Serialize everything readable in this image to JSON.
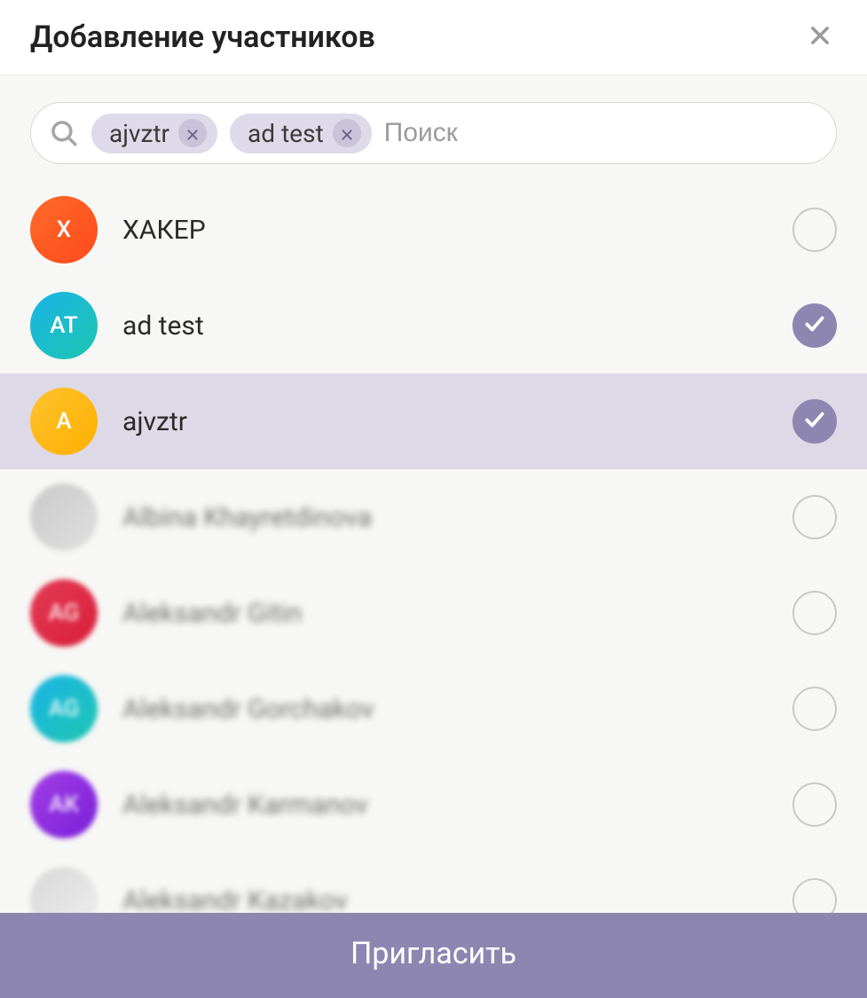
{
  "header": {
    "title": "Добавление участников"
  },
  "search": {
    "placeholder": "Поиск",
    "chips": [
      {
        "label": "ajvztr"
      },
      {
        "label": "ad test"
      }
    ]
  },
  "contacts": [
    {
      "name": "ХАКЕР",
      "initials": "Х",
      "avatar_class": "grad-orange",
      "selected": false,
      "highlighted": false,
      "blurred": false
    },
    {
      "name": "ad test",
      "initials": "AT",
      "avatar_class": "grad-teal",
      "selected": true,
      "highlighted": false,
      "blurred": false
    },
    {
      "name": "ajvztr",
      "initials": "A",
      "avatar_class": "grad-yellow",
      "selected": true,
      "highlighted": true,
      "blurred": false
    },
    {
      "name": "Albina Khayretdinova",
      "initials": "",
      "avatar_class": "grad-photo",
      "selected": false,
      "highlighted": false,
      "blurred": true
    },
    {
      "name": "Aleksandr Gitin",
      "initials": "AG",
      "avatar_class": "grad-red",
      "selected": false,
      "highlighted": false,
      "blurred": true
    },
    {
      "name": "Aleksandr Gorchakov",
      "initials": "AG",
      "avatar_class": "grad-teal2",
      "selected": false,
      "highlighted": false,
      "blurred": true
    },
    {
      "name": "Aleksandr Karmanov",
      "initials": "AK",
      "avatar_class": "grad-purple",
      "selected": false,
      "highlighted": false,
      "blurred": true
    },
    {
      "name": "Aleksandr Kazakov",
      "initials": "",
      "avatar_class": "grad-photo2",
      "selected": false,
      "highlighted": false,
      "blurred": true
    }
  ],
  "footer": {
    "invite_label": "Пригласить"
  }
}
